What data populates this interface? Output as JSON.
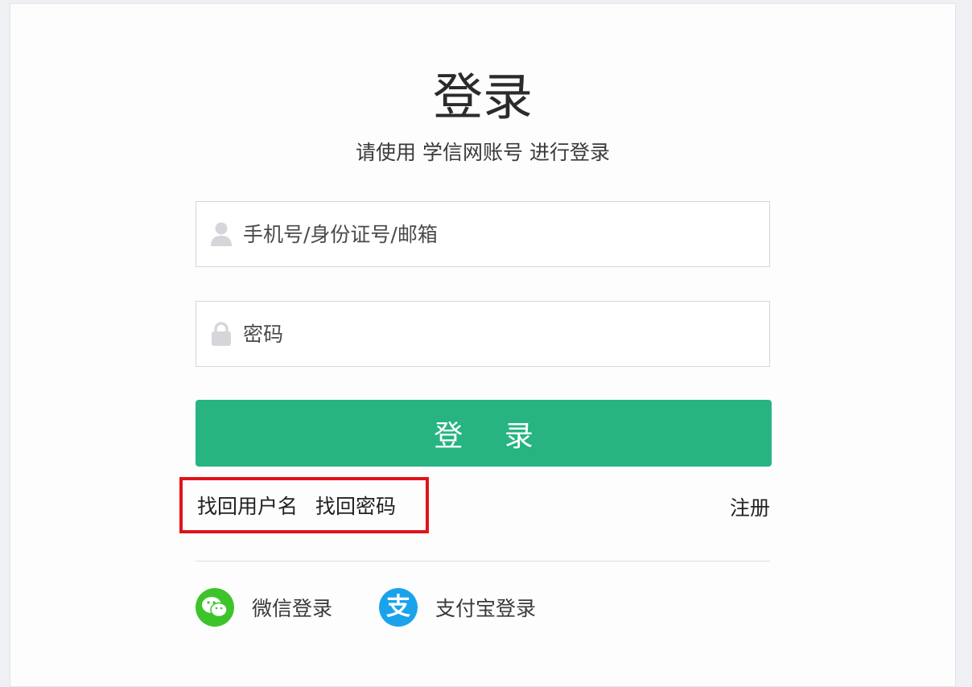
{
  "login": {
    "title": "登录",
    "subtitle": "请使用 学信网账号 进行登录",
    "username_placeholder": "手机号/身份证号/邮箱",
    "password_placeholder": "密码",
    "submit_label": "登 录"
  },
  "links": {
    "find_username": "找回用户名",
    "find_password": "找回密码",
    "register": "注册"
  },
  "social": {
    "wechat_label": "微信登录",
    "alipay_label": "支付宝登录",
    "alipay_glyph": "支"
  },
  "icons": {
    "username": "user-icon",
    "password": "lock-icon",
    "wechat": "wechat-icon",
    "alipay": "alipay-icon"
  },
  "colors": {
    "accent": "#27b481",
    "highlight_box": "#e0131a",
    "wechat": "#3dc42a",
    "alipay": "#1aa3ea"
  }
}
